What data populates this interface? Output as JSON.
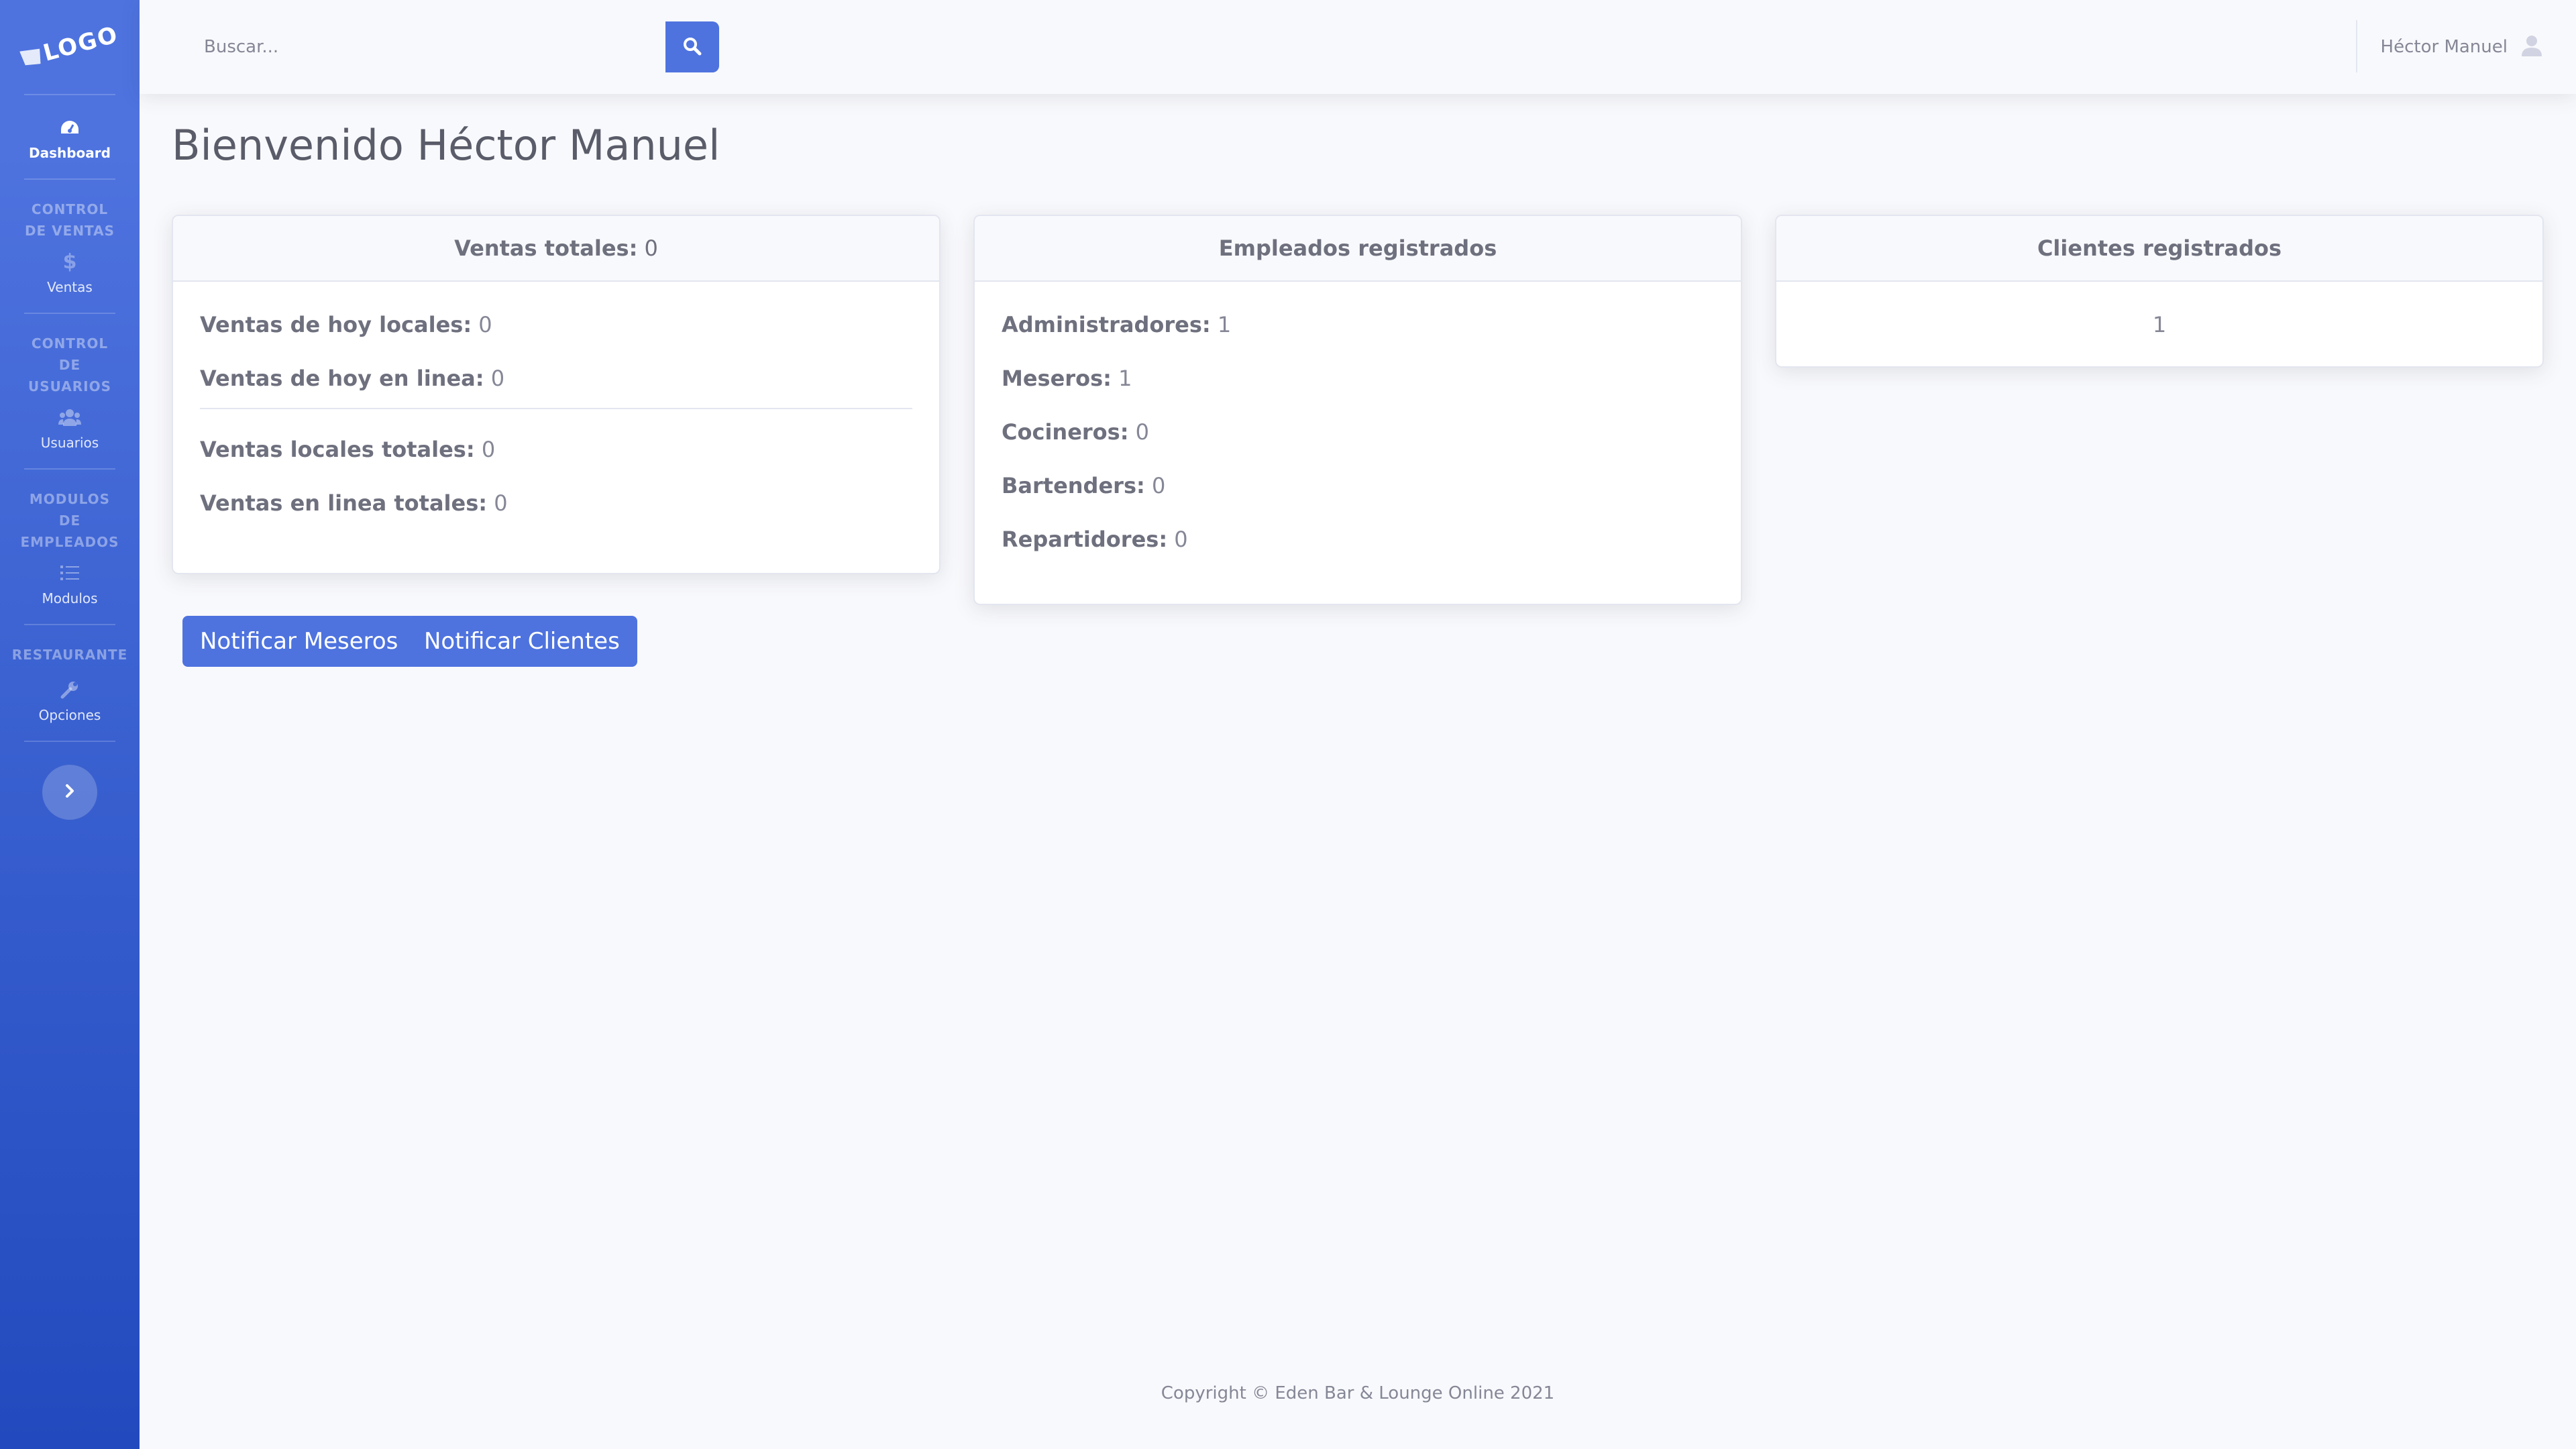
{
  "brand": {
    "logo_text": "LOGO"
  },
  "sidebar": {
    "items": [
      {
        "label": "Dashboard"
      },
      {
        "heading": "CONTROL DE VENTAS",
        "label": "Ventas"
      },
      {
        "heading": "CONTROL DE USUARIOS",
        "label": "Usuarios"
      },
      {
        "heading": "MODULOS DE EMPLEADOS",
        "label": "Modulos"
      },
      {
        "heading": "RESTAURANTE",
        "label": "Opciones"
      }
    ]
  },
  "search": {
    "placeholder": "Buscar..."
  },
  "user": {
    "name": "Héctor Manuel"
  },
  "page": {
    "title": "Bienvenido Héctor Manuel"
  },
  "cards": {
    "ventas": {
      "header_label": "Ventas totales:",
      "header_value": "0",
      "rows": [
        {
          "label": "Ventas de hoy locales:",
          "value": "0"
        },
        {
          "label": "Ventas de hoy en linea:",
          "value": "0"
        },
        {
          "label": "Ventas locales totales:",
          "value": "0"
        },
        {
          "label": "Ventas en linea totales:",
          "value": "0"
        }
      ]
    },
    "empleados": {
      "header": "Empleados registrados",
      "rows": [
        {
          "label": "Administradores:",
          "value": "1"
        },
        {
          "label": "Meseros:",
          "value": "1"
        },
        {
          "label": "Cocineros:",
          "value": "0"
        },
        {
          "label": "Bartenders:",
          "value": "0"
        },
        {
          "label": "Repartidores:",
          "value": "0"
        }
      ]
    },
    "clientes": {
      "header": "Clientes registrados",
      "value": "1"
    }
  },
  "buttons": {
    "notificar_meseros": "Notificar Meseros",
    "notificar_clientes": "Notificar Clientes"
  },
  "footer": {
    "text": "Copyright © Eden Bar & Lounge Online 2021"
  },
  "colors": {
    "primary": "#4e73df",
    "sidebar_dark": "#224abe",
    "text": "#858796"
  }
}
